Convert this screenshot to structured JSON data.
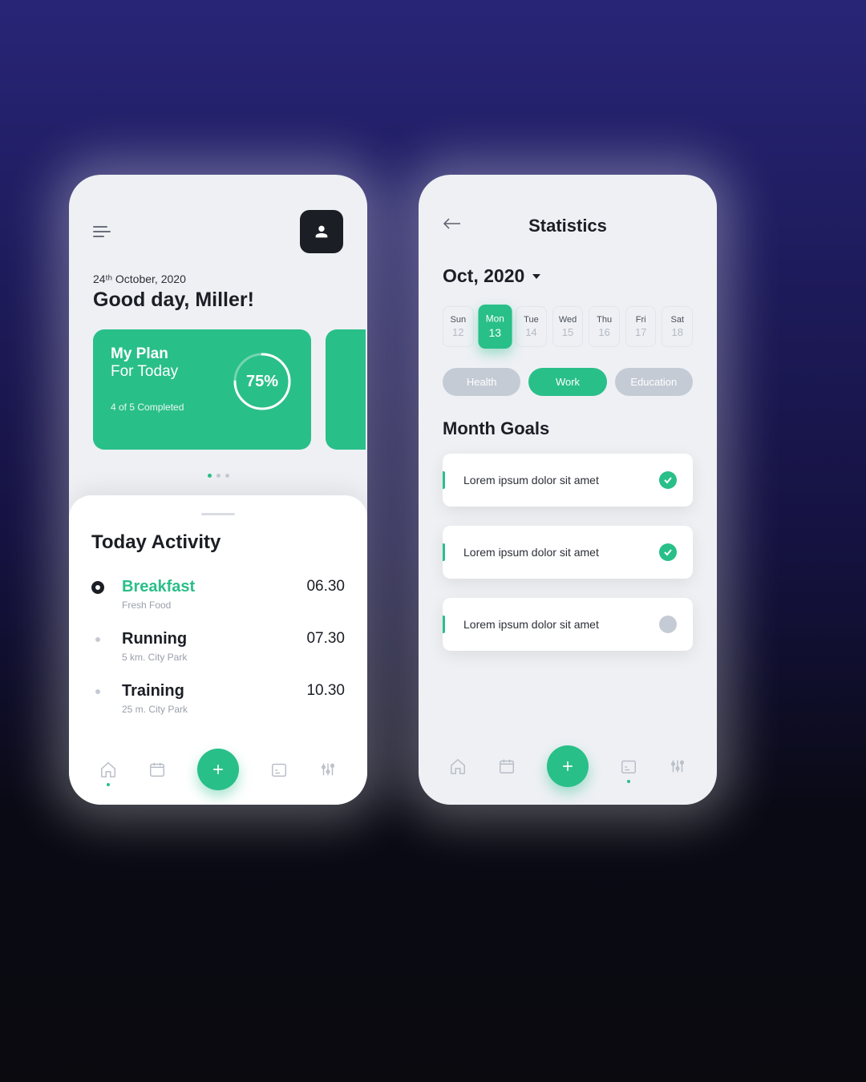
{
  "left": {
    "date_html": "24ᵗʰ October, 2020",
    "greeting": "Good day, Miller!",
    "plan": {
      "title_strong": "My Plan",
      "title": "For Today",
      "progress_pct": "75%",
      "progress_val": 75,
      "completed_text": "4 of 5 Completed"
    },
    "activity_title": "Today Activity",
    "activities": [
      {
        "name": "Breakfast",
        "desc": "Fresh Food",
        "time": "06.30",
        "highlight": true
      },
      {
        "name": "Running",
        "desc": "5 km. City Park",
        "time": "07.30",
        "highlight": false
      },
      {
        "name": "Training",
        "desc": "25 m. City Park",
        "time": "10.30",
        "highlight": false
      }
    ]
  },
  "right": {
    "title": "Statistics",
    "month": "Oct, 2020",
    "days": [
      {
        "name": "Sun",
        "num": "12",
        "sel": false
      },
      {
        "name": "Mon",
        "num": "13",
        "sel": true
      },
      {
        "name": "Tue",
        "num": "14",
        "sel": false
      },
      {
        "name": "Wed",
        "num": "15",
        "sel": false
      },
      {
        "name": "Thu",
        "num": "16",
        "sel": false
      },
      {
        "name": "Fri",
        "num": "17",
        "sel": false
      },
      {
        "name": "Sat",
        "num": "18",
        "sel": false
      }
    ],
    "filters": [
      {
        "label": "Health",
        "on": false
      },
      {
        "label": "Work",
        "on": true
      },
      {
        "label": "Education",
        "on": false
      }
    ],
    "goals_title": "Month Goals",
    "goals": [
      {
        "text": "Lorem ipsum dolor sit amet",
        "done": true
      },
      {
        "text": "Lorem ipsum dolor sit amet",
        "done": true
      },
      {
        "text": "Lorem ipsum dolor sit amet",
        "done": false
      }
    ]
  }
}
